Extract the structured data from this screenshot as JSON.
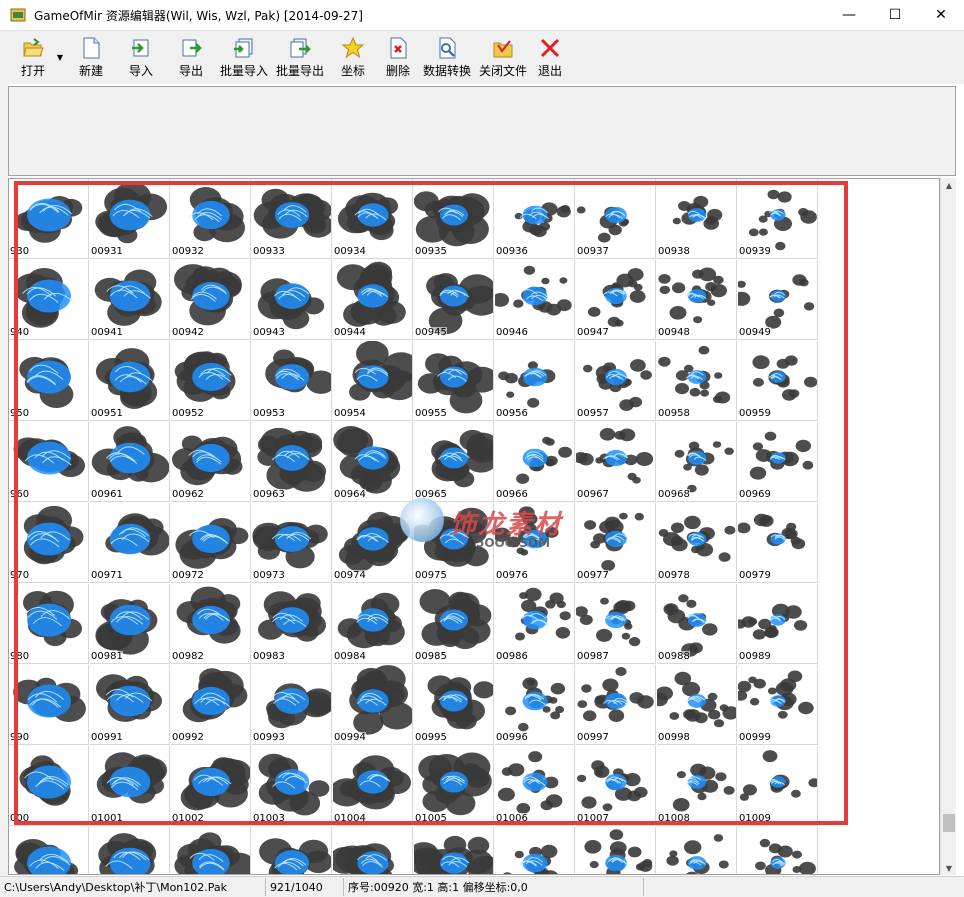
{
  "window": {
    "title": "GameOfMir 资源编辑器(Wil, Wis, Wzl, Pak) [2014-09-27]",
    "minimize_glyph": "—",
    "maximize_glyph": "☐",
    "close_glyph": "✕"
  },
  "toolbar": {
    "buttons": [
      {
        "label": "打开",
        "icon": "open-folder-icon"
      },
      {
        "label": "新建",
        "icon": "new-file-icon"
      },
      {
        "label": "导入",
        "icon": "import-icon"
      },
      {
        "label": "导出",
        "icon": "export-icon"
      },
      {
        "label": "批量导入",
        "icon": "batch-import-icon"
      },
      {
        "label": "批量导出",
        "icon": "batch-export-icon"
      },
      {
        "label": "坐标",
        "icon": "star-icon"
      },
      {
        "label": "删除",
        "icon": "delete-icon"
      },
      {
        "label": "数据转换",
        "icon": "convert-icon"
      },
      {
        "label": "关闭文件",
        "icon": "close-file-icon"
      },
      {
        "label": "退出",
        "icon": "exit-icon"
      }
    ]
  },
  "grid": {
    "rows": [
      [
        "930",
        "00931",
        "00932",
        "00933",
        "00934",
        "00935",
        "00936",
        "00937",
        "00938",
        "00939"
      ],
      [
        "940",
        "00941",
        "00942",
        "00943",
        "00944",
        "00945",
        "00946",
        "00947",
        "00948",
        "00949"
      ],
      [
        "950",
        "00951",
        "00952",
        "00953",
        "00954",
        "00955",
        "00956",
        "00957",
        "00958",
        "00959"
      ],
      [
        "960",
        "00961",
        "00962",
        "00963",
        "00964",
        "00965",
        "00966",
        "00967",
        "00968",
        "00969"
      ],
      [
        "970",
        "00971",
        "00972",
        "00973",
        "00974",
        "00975",
        "00976",
        "00977",
        "00978",
        "00979"
      ],
      [
        "980",
        "00981",
        "00982",
        "00983",
        "00984",
        "00985",
        "00986",
        "00987",
        "00988",
        "00989"
      ],
      [
        "990",
        "00991",
        "00992",
        "00993",
        "00994",
        "00995",
        "00996",
        "00997",
        "00998",
        "00999"
      ],
      [
        "000",
        "01001",
        "01002",
        "01003",
        "01004",
        "01005",
        "01006",
        "01007",
        "01008",
        "01009"
      ],
      [
        "",
        "",
        "",
        "",
        "",
        "",
        "",
        "",
        "",
        ""
      ]
    ]
  },
  "status": {
    "path": "C:\\Users\\Andy\\Desktop\\补丁\\Mon102.Pak",
    "count": "921/1040",
    "info": "序号:00920 宽:1 高:1 偏移坐标:0,0"
  },
  "watermark": {
    "text": "饰龙素材",
    "sub": "5OOO.SOM"
  },
  "colors": {
    "selection_border": "#e93a3a",
    "sprite_blue": "#1e90ff",
    "sprite_dark": "#3a3a3a"
  }
}
